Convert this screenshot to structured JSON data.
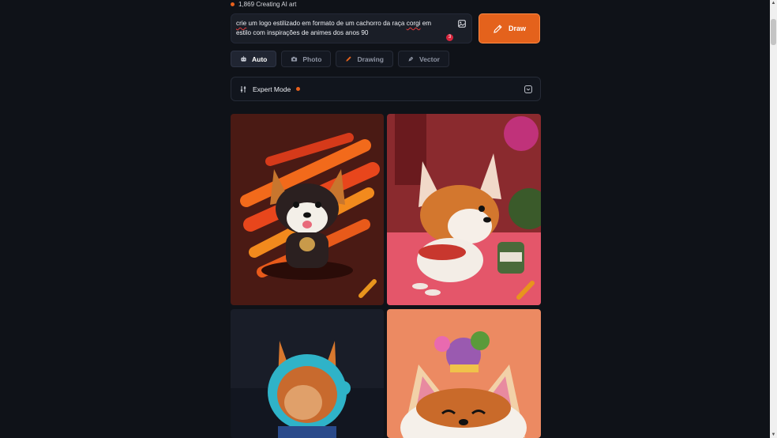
{
  "status": {
    "text": "1,869 Creating AI art"
  },
  "prompt": {
    "word1": "crie",
    "part1": " um logo estilizado em formato de um cachorro da raça ",
    "word2": "corgi",
    "part2": " em",
    "line2": "estilo com inspirações de animes dos anos 90",
    "badge_count": "3"
  },
  "draw_button": {
    "label": "Draw"
  },
  "modes": [
    {
      "label": "Auto",
      "icon": "robot-icon",
      "active": true
    },
    {
      "label": "Photo",
      "icon": "camera-icon",
      "active": false
    },
    {
      "label": "Drawing",
      "icon": "pencil-icon",
      "active": false
    },
    {
      "label": "Vector",
      "icon": "pen-nib-icon",
      "active": false
    }
  ],
  "expert_mode": {
    "label": "Expert Mode"
  },
  "colors": {
    "accent": "#e4621c",
    "background": "#0f1218",
    "panel": "#1a1e27"
  }
}
